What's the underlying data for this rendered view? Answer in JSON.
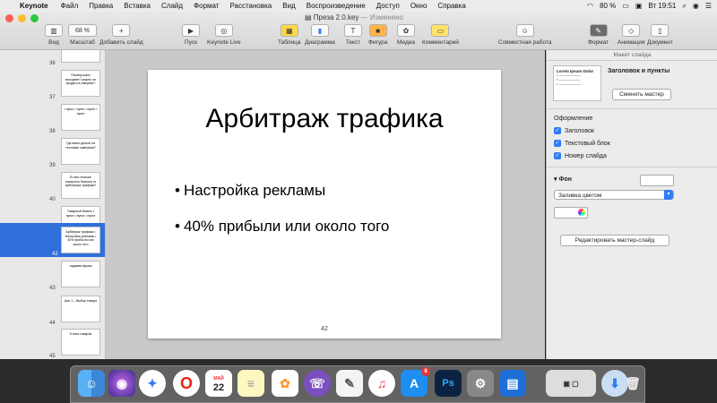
{
  "menubar": {
    "app_name": "Keynote",
    "menus": [
      "Файл",
      "Правка",
      "Вставка",
      "Слайд",
      "Формат",
      "Расстановка",
      "Вид",
      "Воспроизведение",
      "Доступ",
      "Окно",
      "Справка"
    ],
    "battery": "80 %",
    "clock": "Вт 19:51"
  },
  "window": {
    "doc_name": "Преза 2.0.key",
    "doc_status": "— Изменено"
  },
  "toolbar": {
    "view": "Вид",
    "zoom_value": "68 %",
    "zoom": "Масштаб",
    "add_slide": "Добавить слайд",
    "play": "Пуск",
    "keynote_live": "Keynote Live",
    "table": "Таблица",
    "chart": "Диаграмма",
    "text": "Текст",
    "shape": "Фигура",
    "media": "Медиа",
    "comment": "Комментарий",
    "collab": "Совместная работа",
    "format": "Формат",
    "animate": "Анимация",
    "document": "Документ"
  },
  "sidebar": {
    "slides": [
      {
        "num": "36",
        "text": ""
      },
      {
        "num": "37",
        "text": "Почему шанс выгоднее? можно ли продать в Америке?"
      },
      {
        "num": "38",
        "text": "• пункт • пункт • пункт • пункт"
      },
      {
        "num": "39",
        "text": "Где взять деньги на тестовые кампании?"
      },
      {
        "num": "40",
        "text": "В чем отличие товарного бизнеса от арбитража трафика?"
      },
      {
        "num": "41",
        "text": "Товарный бизнес • пункт • пункт • пункт"
      },
      {
        "num": "42",
        "text": "Арбитраж трафика • Настройка рекламы • 40% прибыли или около того",
        "selected": true
      },
      {
        "num": "43",
        "text": "ладовая фраза"
      },
      {
        "num": "44",
        "text": "Шаг 1 – Выбор товара"
      },
      {
        "num": "45",
        "text": "5 типа товаров"
      }
    ]
  },
  "slide": {
    "title": "Арбитраж трафика",
    "bullets": [
      "Настройка рекламы",
      "40% прибыли или около того"
    ],
    "page_number": "42"
  },
  "inspector": {
    "header": "Макет слайда",
    "master_thumb_text": "Lorem Ipsum Dolor",
    "master_name": "Заголовок и пункты",
    "change_master": "Сменить мастер",
    "appearance": "Оформление",
    "checkboxes": [
      "Заголовок",
      "Текстовый блок",
      "Номер слайда"
    ],
    "background": "Фон",
    "fill_option": "Заливка цветом",
    "edit_master": "Редактировать мастер-слайд"
  },
  "dock": {
    "calendar_month": "МАЙ",
    "calendar_day": "22",
    "appstore_badge": "8",
    "photoshop": "Ps"
  },
  "colors": {
    "selection": "#2f6fdc",
    "accent": "#2e7cf6"
  }
}
